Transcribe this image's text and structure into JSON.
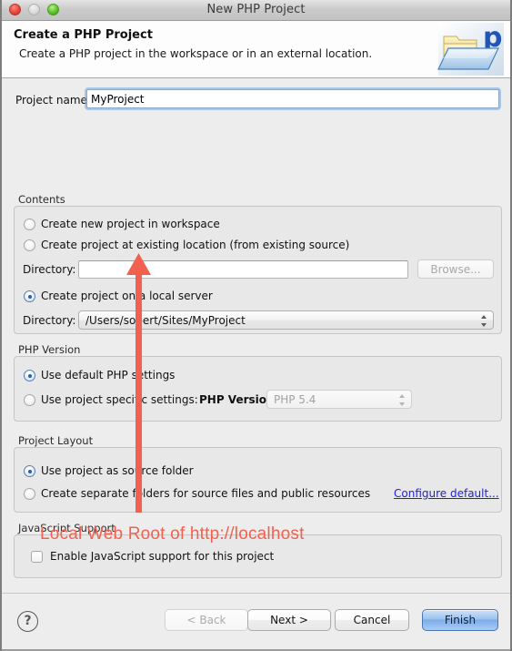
{
  "window": {
    "title": "New PHP Project",
    "traffic_lights": [
      "close",
      "minimize",
      "zoom"
    ]
  },
  "banner": {
    "title": "Create a PHP Project",
    "subtitle": "Create a PHP project in the workspace or in an external location.",
    "icon": "php-folder-icon"
  },
  "project_name": {
    "label": "Project name:",
    "value": "MyProject",
    "placeholder": ""
  },
  "contents": {
    "group_label": "Contents",
    "options": [
      {
        "label": "Create new project in workspace",
        "selected": false
      },
      {
        "label": "Create project at existing location (from existing source)",
        "selected": false
      },
      {
        "label": "Create project on a local server",
        "selected": true
      }
    ],
    "existing_directory": {
      "label": "Directory:",
      "value": "",
      "placeholder": "",
      "browse_label": "Browse..."
    },
    "server_directory": {
      "label": "Directory:",
      "value": "/Users/sobert/Sites/MyProject"
    }
  },
  "php_version": {
    "group_label": "PHP Version",
    "options": [
      {
        "label": "Use default PHP settings",
        "selected": true
      },
      {
        "label": "Use project specific settings:",
        "selected": false
      }
    ],
    "version_label": "PHP Version:",
    "version_value": "PHP 5.4"
  },
  "project_layout": {
    "group_label": "Project Layout",
    "options": [
      {
        "label": "Use project as source folder",
        "selected": true
      },
      {
        "label": "Create separate folders for source files and public resources",
        "selected": false
      }
    ],
    "configure_link": "Configure default..."
  },
  "javascript_support": {
    "group_label": "JavaScript Support",
    "checkbox_label": "Enable JavaScript support for this project",
    "checked": false
  },
  "annotation": {
    "text": "Local Web Root of http://localhost",
    "color": "#f2614f",
    "arrow": "up-arrow-annotation"
  },
  "footer": {
    "help_label": "?",
    "back_label": "< Back",
    "next_label": "Next >",
    "cancel_label": "Cancel",
    "finish_label": "Finish",
    "back_disabled": true,
    "finish_default": true
  },
  "colors": {
    "accent": "#7cacea",
    "link": "#2222cc",
    "annotation": "#f2614f",
    "window_bg": "#ededed",
    "group_bg": "#e8e8e8"
  }
}
